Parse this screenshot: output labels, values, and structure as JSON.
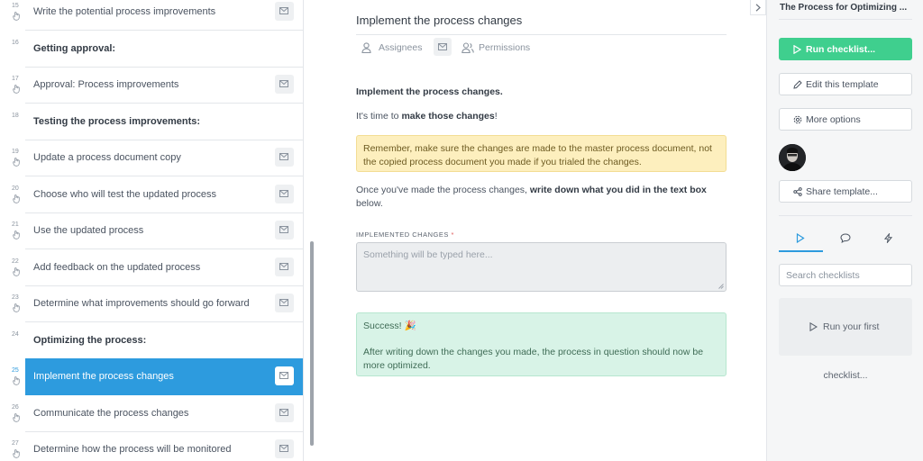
{
  "task_list": {
    "rows": [
      {
        "num": "15",
        "label": "Write the potential process improvements",
        "heading": false,
        "active": false,
        "hand": true,
        "mail": true
      },
      {
        "num": "16",
        "label": "Getting approval:",
        "heading": true,
        "active": false,
        "hand": false,
        "mail": false
      },
      {
        "num": "17",
        "label": "Approval: Process improvements",
        "heading": false,
        "active": false,
        "hand": true,
        "mail": true
      },
      {
        "num": "18",
        "label": "Testing the process improvements:",
        "heading": true,
        "active": false,
        "hand": false,
        "mail": false
      },
      {
        "num": "19",
        "label": "Update a process document copy",
        "heading": false,
        "active": false,
        "hand": true,
        "mail": true
      },
      {
        "num": "20",
        "label": "Choose who will test the updated process",
        "heading": false,
        "active": false,
        "hand": true,
        "mail": true
      },
      {
        "num": "21",
        "label": "Use the updated process",
        "heading": false,
        "active": false,
        "hand": true,
        "mail": true
      },
      {
        "num": "22",
        "label": "Add feedback on the updated process",
        "heading": false,
        "active": false,
        "hand": true,
        "mail": true
      },
      {
        "num": "23",
        "label": "Determine what improvements should go forward",
        "heading": false,
        "active": false,
        "hand": true,
        "mail": true
      },
      {
        "num": "24",
        "label": "Optimizing the process:",
        "heading": true,
        "active": false,
        "hand": false,
        "mail": false
      },
      {
        "num": "25",
        "label": "Implement the process changes",
        "heading": false,
        "active": true,
        "hand": true,
        "mail": true
      },
      {
        "num": "26",
        "label": "Communicate the process changes",
        "heading": false,
        "active": false,
        "hand": true,
        "mail": true
      },
      {
        "num": "27",
        "label": "Determine how the process will be monitored",
        "heading": false,
        "active": false,
        "hand": true,
        "mail": true
      }
    ]
  },
  "task": {
    "title": "Implement the process changes",
    "assignees_label": "Assignees",
    "permissions_label": "Permissions",
    "heading": "Implement the process changes.",
    "intro_plain": "It's time to ",
    "intro_bold": "make those changes",
    "intro_end": "!",
    "warning": "Remember, make sure the changes are made to the master process document, not the copied process document you made if you trialed the changes.",
    "instruction_plain": "Once you've made the process changes, ",
    "instruction_bold": "write down what you did in the text box",
    "instruction_end": " below.",
    "field_label": "IMPLEMENTED CHANGES",
    "field_required": "*",
    "field_placeholder": "Something will be typed here...",
    "success_title": "Success! 🎉",
    "success_body": "After writing down the changes you made, the process in question should now be more optimized."
  },
  "sidebar": {
    "title": "The Process for Optimizing ...",
    "run_checklist": "Run checklist...",
    "edit_template": "Edit this template",
    "more_options": "More options",
    "share_template": "Share template...",
    "search_placeholder": "Search checklists",
    "run_first": "Run your first",
    "checklist_text": "checklist..."
  },
  "colors": {
    "accent": "#2d9bde",
    "run_button": "#3fcf8e",
    "warning_bg": "#fdefbe",
    "success_bg": "#d8f3e7"
  },
  "icons": [
    "mail-icon",
    "hand-icon",
    "user-icon",
    "users-icon",
    "play-icon",
    "pencil-icon",
    "gear-icon",
    "share-icon",
    "comment-icon",
    "bolt-icon",
    "chevron-right-icon"
  ]
}
